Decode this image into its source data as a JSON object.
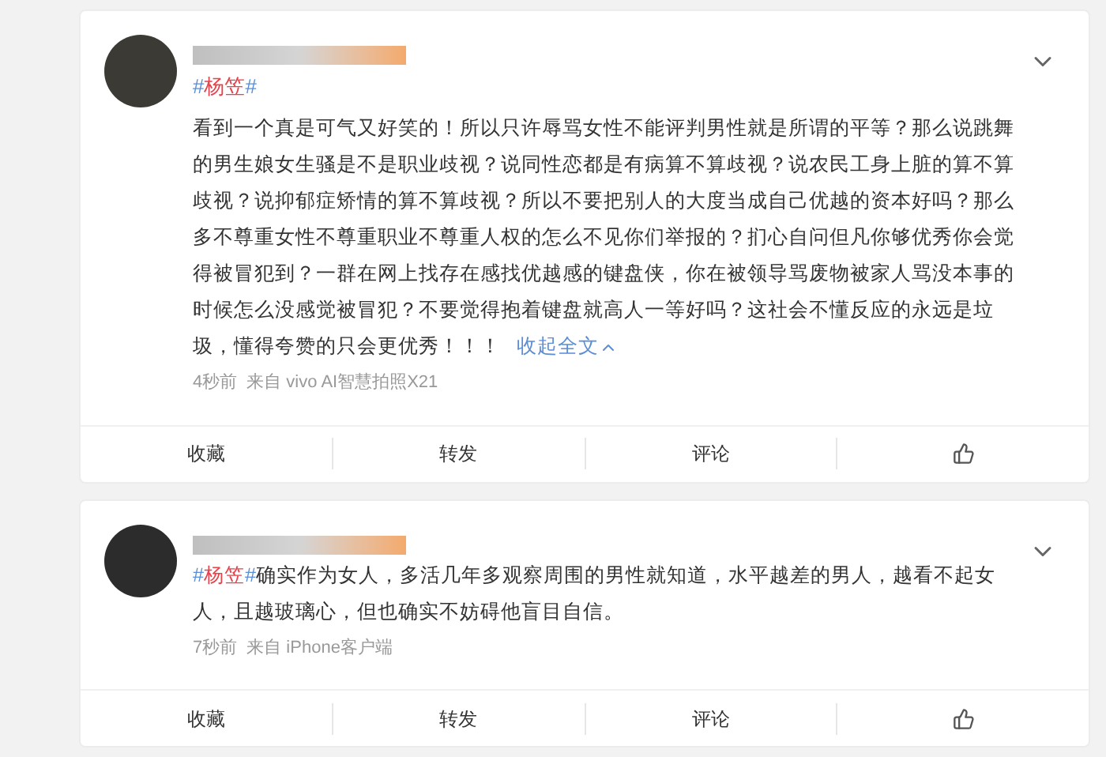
{
  "posts": [
    {
      "hashtag": {
        "open": "#",
        "label": "杨笠",
        "close": "#"
      },
      "hashtag_own_line": true,
      "text": "看到一个真是可气又好笑的！所以只许辱骂女性不能评判男性就是所谓的平等？那么说跳舞的男生娘女生骚是不是职业歧视？说同性恋都是有病算不算歧视？说农民工身上脏的算不算歧视？说抑郁症矫情的算不算歧视？所以不要把别人的大度当成自己优越的资本好吗？那么多不尊重女性不尊重职业不尊重人权的怎么不见你们举报的？扪心自问但凡你够优秀你会觉得被冒犯到？一群在网上找存在感找优越感的键盘侠，你在被领导骂废物被家人骂没本事的时候怎么没感觉被冒犯？不要觉得抱着键盘就高人一等好吗？这社会不懂反应的永远是垃圾，懂得夸赞的只会更优秀！！！",
      "collapse_link": "收起全文",
      "time": "4秒前",
      "source": "来自 vivo AI智慧拍照X21",
      "actions": [
        "收藏",
        "转发",
        "评论"
      ]
    },
    {
      "hashtag": {
        "open": "#",
        "label": "杨笠",
        "close": "#"
      },
      "hashtag_own_line": false,
      "text": "确实作为女人，多活几年多观察周围的男性就知道，水平越差的男人，越看不起女人，且越玻璃心，但也确实不妨碍他盲目自信。",
      "time": "7秒前",
      "source": "来自 iPhone客户端",
      "actions": [
        "收藏",
        "转发",
        "评论"
      ]
    }
  ]
}
